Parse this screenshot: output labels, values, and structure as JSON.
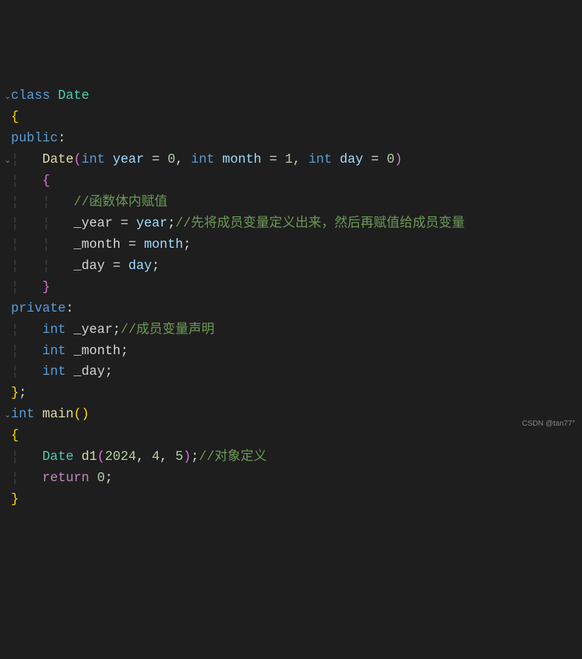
{
  "code": {
    "line1": {
      "kw_class": "class",
      "name": "Date"
    },
    "line2": {
      "brace": "{"
    },
    "line3": {
      "modifier": "public",
      "colon": ":"
    },
    "line4": {
      "ctor": "Date",
      "lp": "(",
      "t1": "int",
      "p1": "year",
      "eq1": " = ",
      "n1": "0",
      "c1": ", ",
      "t2": "int",
      "p2": "month",
      "eq2": " = ",
      "n2": "1",
      "c2": ", ",
      "t3": "int",
      "p3": "day",
      "eq3": " = ",
      "n3": "0",
      "rp": ")"
    },
    "line5": {
      "brace": "{"
    },
    "line6": {
      "comment": "//函数体内赋值"
    },
    "line7": {
      "var": "_year",
      "eq": " = ",
      "val": "year",
      "semi": ";",
      "comment": "//先将成员变量定义出来，然后再赋值给成员变量"
    },
    "line8": {
      "var": "_month",
      "eq": " = ",
      "val": "month",
      "semi": ";"
    },
    "line9": {
      "var": "_day",
      "eq": " = ",
      "val": "day",
      "semi": ";"
    },
    "line10": {
      "brace": "}"
    },
    "line11": {
      "modifier": "private",
      "colon": ":"
    },
    "line12": {
      "type": "int",
      "var": "_year",
      "semi": ";",
      "comment": "//成员变量声明"
    },
    "line13": {
      "type": "int",
      "var": "_month",
      "semi": ";"
    },
    "line14": {
      "type": "int",
      "var": "_day",
      "semi": ";"
    },
    "line15": {
      "brace": "}",
      "semi": ";"
    },
    "line16": {
      "type": "int",
      "func": "main",
      "lp": "(",
      "rp": ")"
    },
    "line17": {
      "brace": "{"
    },
    "line18": {
      "type": "Date",
      "var": "d1",
      "lp": "(",
      "n1": "2024",
      "c1": ", ",
      "n2": "4",
      "c2": ", ",
      "n3": "5",
      "rp": ")",
      "semi": ";",
      "comment": "//对象定义"
    },
    "line19": {
      "ret": "return",
      "val": "0",
      "semi": ";"
    },
    "line20": {
      "brace": "}"
    }
  },
  "watermark": "CSDN @tan77°"
}
